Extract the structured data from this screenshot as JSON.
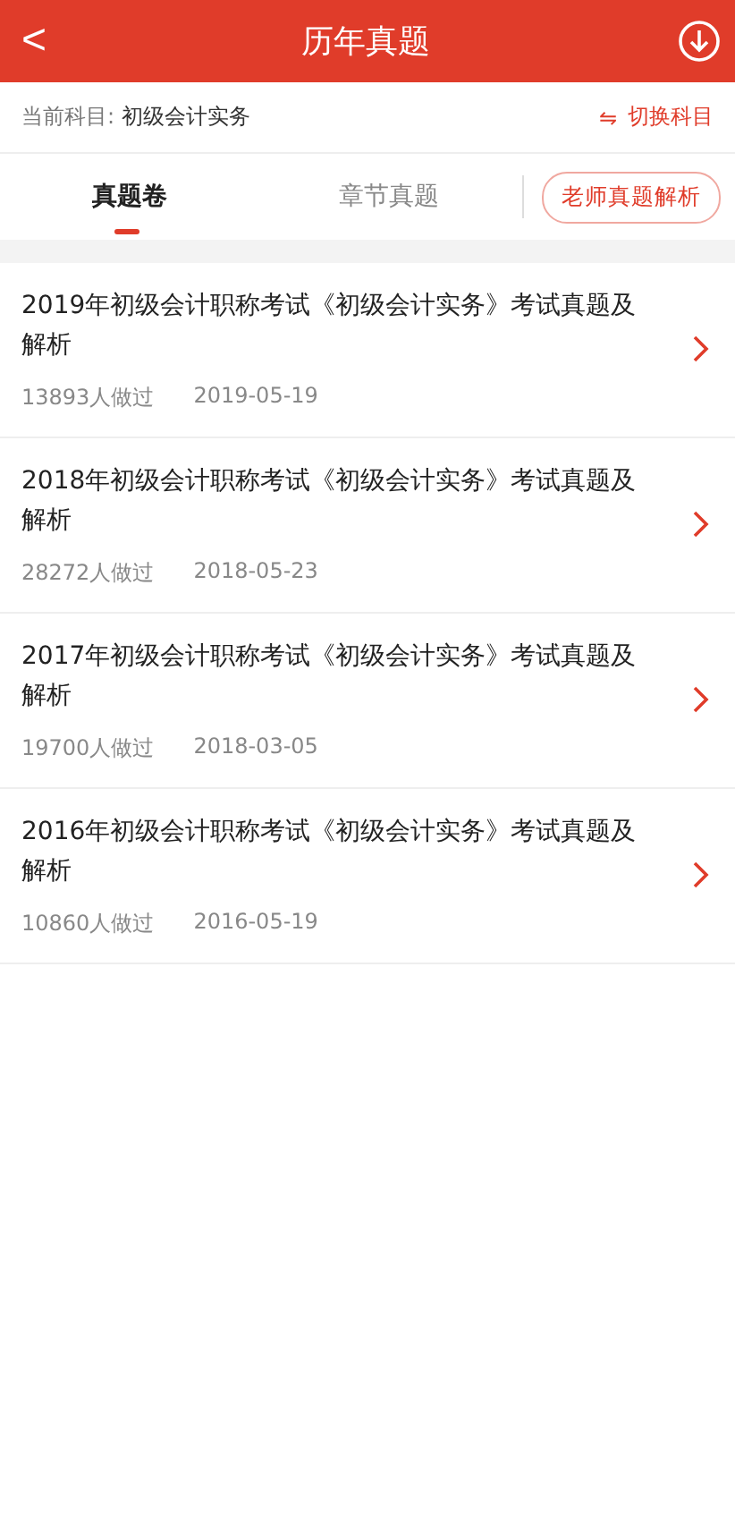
{
  "header": {
    "back": "<",
    "title": "历年真题"
  },
  "subject": {
    "label": "当前科目:",
    "value": "初级会计实务",
    "switch_icon": "⇋",
    "switch": "切换科目"
  },
  "tabs": [
    {
      "label": "真题卷",
      "selected": true
    },
    {
      "label": "章节真题",
      "selected": false
    }
  ],
  "teacher_button": "老师真题解析",
  "papers": [
    {
      "title": "2019年初级会计职称考试《初级会计实务》考试真题及解析",
      "count": "13893人做过",
      "date": "2019-05-19"
    },
    {
      "title": "2018年初级会计职称考试《初级会计实务》考试真题及解析",
      "count": "28272人做过",
      "date": "2018-05-23"
    },
    {
      "title": "2017年初级会计职称考试《初级会计实务》考试真题及解析",
      "count": "19700人做过",
      "date": "2018-03-05"
    },
    {
      "title": "2016年初级会计职称考试《初级会计实务》考试真题及解析",
      "count": "10860人做过",
      "date": "2016-05-19"
    }
  ]
}
